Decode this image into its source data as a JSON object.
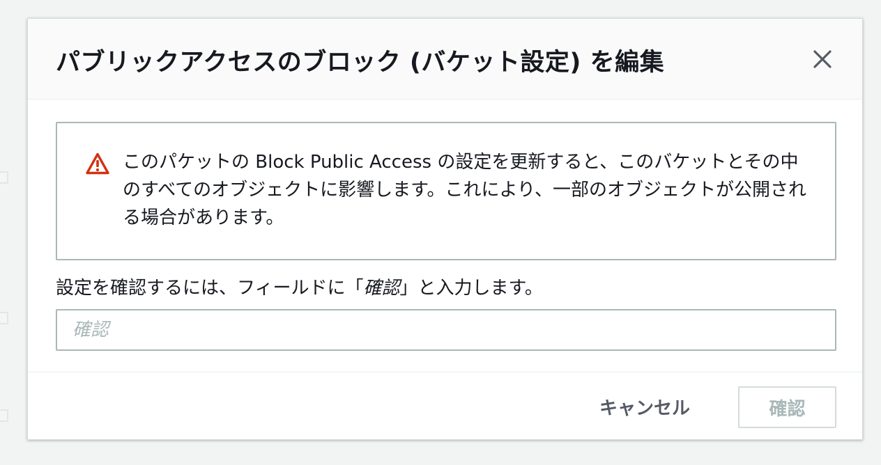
{
  "modal": {
    "title": "パブリックアクセスのブロック (バケット設定) を編集",
    "close_icon": "close-icon",
    "alert": {
      "icon": "warning-icon",
      "icon_color": "#d13212",
      "message": "このパケットの Block Public Access の設定を更新すると、このバケットとその中のすべてのオブジェクトに影響します。これにより、一部のオブジェクトが公開される場合があります。"
    },
    "confirmation": {
      "instruction_before": "設定を確認するには、フィールドに「",
      "instruction_keyword": "確認",
      "instruction_after": "」と入力します。",
      "input_value": "",
      "input_placeholder": "確認"
    },
    "footer": {
      "cancel_label": "キャンセル",
      "confirm_label": "確認"
    }
  }
}
